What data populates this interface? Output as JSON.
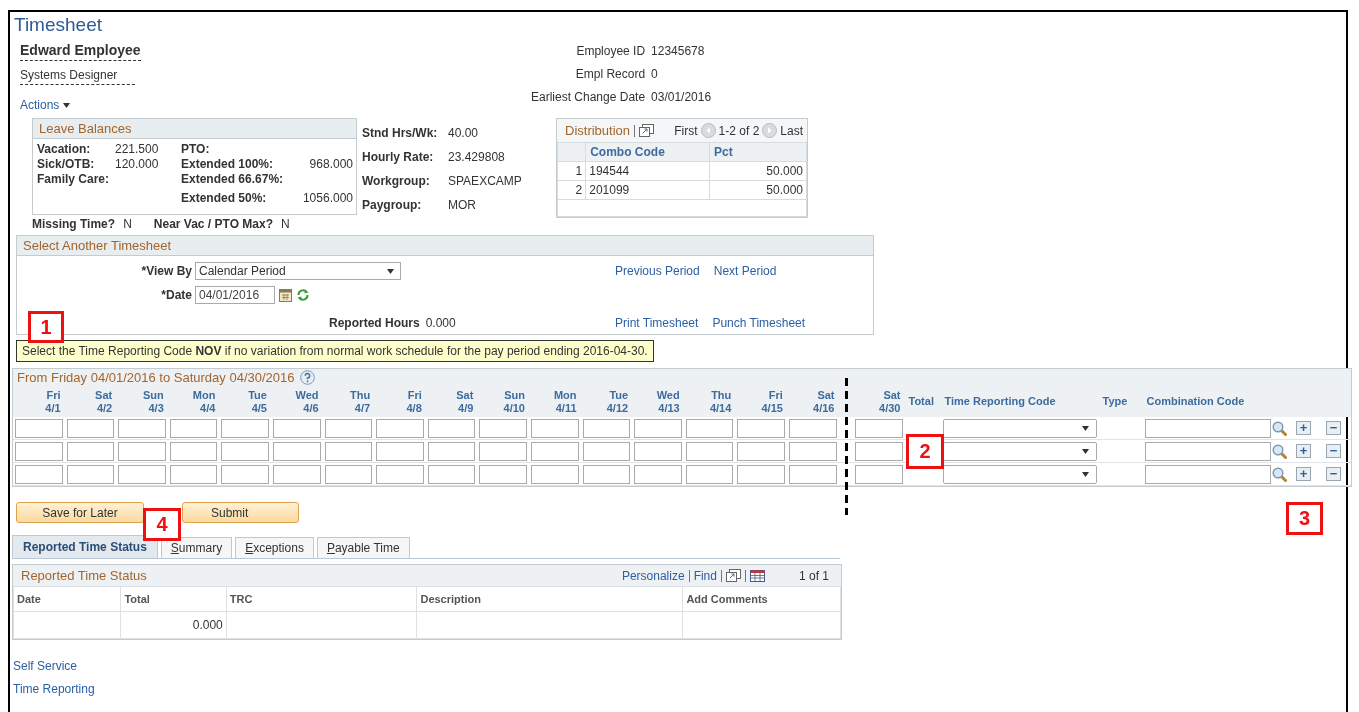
{
  "page_title": "Timesheet",
  "employee": {
    "name": "Edward Employee",
    "job_title": "Systems Designer",
    "actions": "Actions"
  },
  "employee_info": [
    {
      "label": "Employee ID",
      "value": "12345678"
    },
    {
      "label": "Empl Record",
      "value": "0"
    },
    {
      "label": "Earliest Change Date",
      "value": "03/01/2016"
    }
  ],
  "leave_balances": {
    "title": "Leave Balances",
    "rows": [
      {
        "label_1": "Vacation:",
        "value_1": "221.500",
        "label_2": "PTO:"
      },
      {
        "label_1": "Sick/OTB:",
        "value_1": "120.000",
        "label_2": "Extended 100%:",
        "value_2": "968.000"
      },
      {
        "label_1": "Family Care:",
        "label_2": "Extended 66.67%:"
      },
      {
        "label_2": "Extended 50%:",
        "value_2": "1056.000"
      }
    ]
  },
  "job_details": [
    {
      "label": "Stnd Hrs/Wk:",
      "value": "40.00"
    },
    {
      "label": "Hourly Rate:",
      "value": "23.429808"
    },
    {
      "label": "Workgroup:",
      "value": "SPAEXCAMP"
    },
    {
      "label": "Paygroup:",
      "value": "MOR"
    }
  ],
  "distribution": {
    "title": "Distribution",
    "first": "First",
    "range": "1-2 of 2",
    "last": "Last",
    "columns": [
      "Combo Code",
      "Pct"
    ],
    "rows": [
      {
        "num": "1",
        "combo_code": "194544",
        "pct": "50.000"
      },
      {
        "num": "2",
        "combo_code": "201099",
        "pct": "50.000"
      }
    ]
  },
  "flags": [
    {
      "label": "Missing Time?",
      "value": "N"
    },
    {
      "label": "Near Vac / PTO Max?",
      "value": "N"
    }
  ],
  "select_timesheet": {
    "title": "Select Another Timesheet",
    "view_by_label": "*View By",
    "view_by": "Calendar Period",
    "date_label": "*Date",
    "date": "04/01/2016",
    "reported_hours_label": "Reported Hours",
    "reported_hours": "0.000",
    "links": [
      "Previous Period",
      "Next Period",
      "Print Timesheet",
      "Punch Timesheet"
    ]
  },
  "notice": "Select the Time Reporting Code **NOV** if no variation from normal work schedule for the pay period ending 2016-04-30.",
  "time_grid": {
    "title": "From Friday 04/01/2016 to Saturday 04/30/2016",
    "days": [
      {
        "dow": "Fri",
        "date": "4/1"
      },
      {
        "dow": "Sat",
        "date": "4/2"
      },
      {
        "dow": "Sun",
        "date": "4/3"
      },
      {
        "dow": "Mon",
        "date": "4/4"
      },
      {
        "dow": "Tue",
        "date": "4/5"
      },
      {
        "dow": "Wed",
        "date": "4/6"
      },
      {
        "dow": "Thu",
        "date": "4/7"
      },
      {
        "dow": "Fri",
        "date": "4/8"
      },
      {
        "dow": "Sat",
        "date": "4/9"
      },
      {
        "dow": "Sun",
        "date": "4/10"
      },
      {
        "dow": "Mon",
        "date": "4/11"
      },
      {
        "dow": "Tue",
        "date": "4/12"
      },
      {
        "dow": "Wed",
        "date": "4/13"
      },
      {
        "dow": "Thu",
        "date": "4/14"
      },
      {
        "dow": "Fri",
        "date": "4/15"
      },
      {
        "dow": "Sat",
        "date": "4/16"
      }
    ],
    "last_day": {
      "dow": "Sat",
      "date": "4/30"
    },
    "columns": [
      "Total",
      "Time Reporting Code",
      "Type",
      "Combination Code"
    ],
    "rows": [
      {
        "add": "+",
        "delete": "−"
      },
      {
        "add": "+",
        "delete": "−"
      },
      {
        "add": "+",
        "delete": "−"
      }
    ]
  },
  "buttons": [
    "Save for Later",
    "Submit"
  ],
  "tabs": [
    {
      "label": "Reported Time Status",
      "selected": true
    },
    {
      "label": "Summary",
      "selected": false
    },
    {
      "label": "Exceptions",
      "selected": false
    },
    {
      "label": "Payable Time",
      "selected": false
    }
  ],
  "status_table": {
    "title": "Reported Time Status",
    "tools": [
      "Personalize",
      "Find"
    ],
    "count": "1 of 1",
    "columns": [
      "Date",
      "Total",
      "TRC",
      "Description",
      "Add Comments"
    ],
    "rows": [
      {
        "total": "0.000"
      }
    ]
  },
  "footer_links": [
    "Self Service",
    "Time Reporting"
  ],
  "callouts": [
    {
      "number": "1"
    },
    {
      "number": "2"
    },
    {
      "number": "3"
    },
    {
      "number": "4"
    }
  ]
}
